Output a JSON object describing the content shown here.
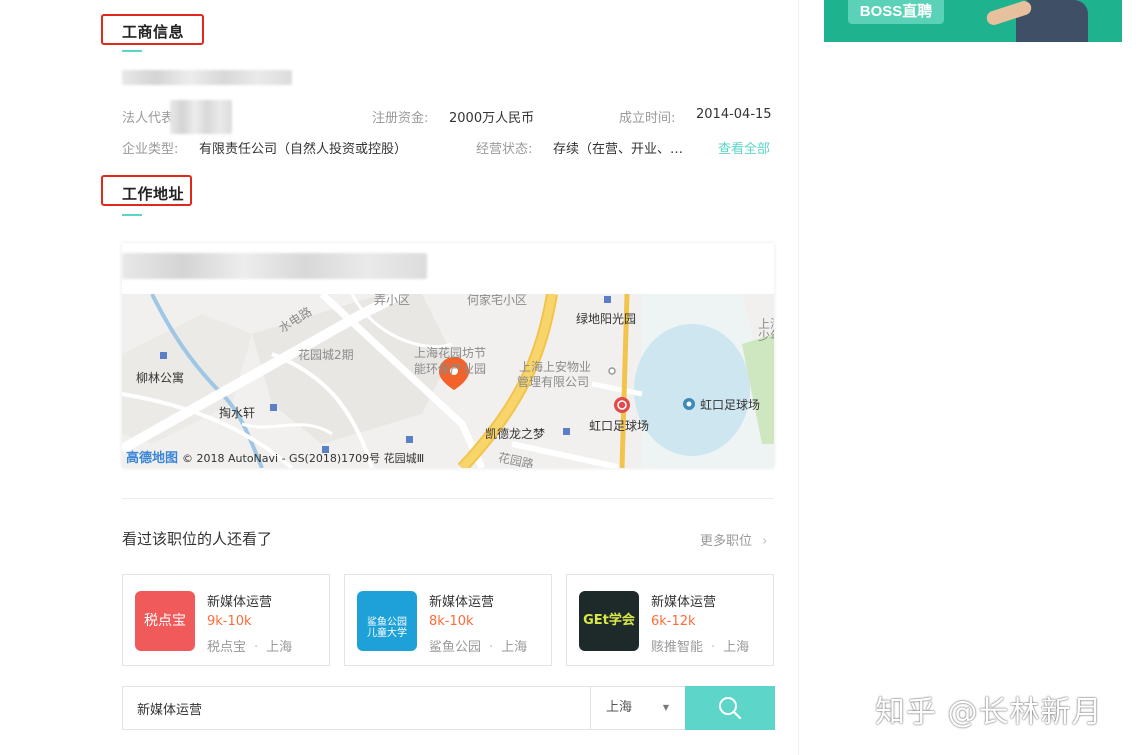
{
  "ad": {
    "badge": "BOSS直聘"
  },
  "business_info": {
    "title": "工商信息",
    "legal_rep_label": "法人代表",
    "reg_capital_label": "注册资金:",
    "reg_capital_value": "2000万人民币",
    "established_label": "成立时间:",
    "established_value": "2014-04-15",
    "company_type_label": "企业类型:",
    "company_type_value": "有限责任公司（自然人投资或控股）",
    "status_label": "经营状态:",
    "status_value": "存续（在营、开业、…",
    "view_all": "查看全部"
  },
  "work_address": {
    "title": "工作地址",
    "map": {
      "labels": {
        "top_a": "弄小区",
        "top_b": "何家宅小区",
        "lvdi": "绿地阳光园",
        "road": "水电路",
        "huayuan2": "花园城2期",
        "liulin": "柳林公寓",
        "taoshuixuan": "掏水轩",
        "park_a": "上海花园坊节",
        "park_b": "能环保产业园",
        "shangan_a": "上海上安物业",
        "shangan_b": "管理有限公司",
        "kaide": "凯德龙之梦",
        "hongkou_metro": "虹口足球场",
        "hongkou_stadium": "虹口足球场",
        "huayuanlu": "花园路",
        "right_edge": "上海\n少年"
      },
      "logo": "高德地图",
      "copyright": "© 2018 AutoNavi - GS(2018)1709号 花园城Ⅲ"
    }
  },
  "recommend": {
    "title": "看过该职位的人还看了",
    "more": "更多职位",
    "jobs": [
      {
        "logo_text": "税点宝",
        "name": "新媒体运营",
        "salary": "9k-10k",
        "company": "税点宝",
        "city": "上海",
        "logo_color": "#f05a5b"
      },
      {
        "logo_text": "鲨鱼公园\n儿童大学",
        "name": "新媒体运营",
        "salary": "8k-10k",
        "company": "鲨鱼公园",
        "city": "上海",
        "logo_color": "#1ea0d8"
      },
      {
        "logo_text": "GEt学会",
        "name": "新媒体运营",
        "salary": "6k-12k",
        "company": "赅推智能",
        "city": "上海",
        "logo_color": "#1e2a2a"
      }
    ]
  },
  "search": {
    "value": "新媒体运营",
    "city": "上海"
  },
  "watermark": "知乎 @长林新月"
}
